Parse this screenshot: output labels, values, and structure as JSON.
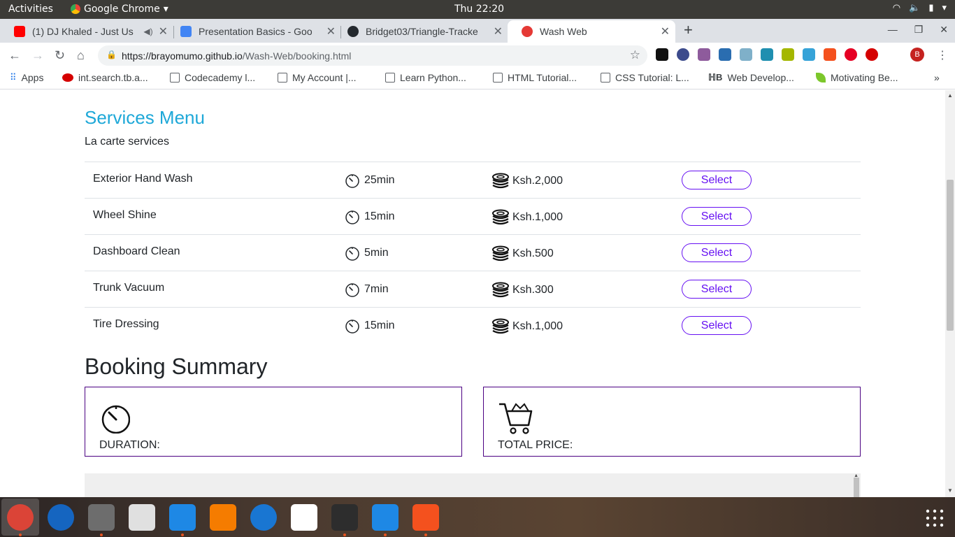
{
  "system": {
    "activities": "Activities",
    "app_name": "Google Chrome",
    "clock": "Thu 22:20"
  },
  "tabs": [
    {
      "title": "(1) DJ Khaled - Just Us",
      "icon_color": "#ff0000"
    },
    {
      "title": "Presentation Basics - Goo",
      "icon_color": "#4285f4"
    },
    {
      "title": "Bridget03/Triangle-Tracke",
      "icon_color": "#24292e"
    },
    {
      "title": "Wash Web",
      "icon_color": "#e53935"
    }
  ],
  "omnibox": {
    "host": "https://brayomumo.github.io",
    "path": "/Wash-Web/booking.html"
  },
  "bookmarks": [
    {
      "label": "Apps"
    },
    {
      "label": "int.search.tb.a..."
    },
    {
      "label": "Codecademy l..."
    },
    {
      "label": "My Account |..."
    },
    {
      "label": "Learn Python..."
    },
    {
      "label": "HTML Tutorial..."
    },
    {
      "label": "CSS Tutorial: L..."
    },
    {
      "label": "Web Develop..."
    },
    {
      "label": "Motivating Be..."
    }
  ],
  "avatar_letter": "B",
  "services": {
    "title": "Services Menu",
    "subtitle": "La carte services",
    "select_label": "Select",
    "rows": [
      {
        "name": "Exterior Hand Wash",
        "duration": "25min",
        "price": "Ksh.2,000"
      },
      {
        "name": "Wheel Shine",
        "duration": "15min",
        "price": "Ksh.1,000"
      },
      {
        "name": "Dashboard Clean",
        "duration": "5min",
        "price": "Ksh.500"
      },
      {
        "name": "Trunk Vacuum",
        "duration": "7min",
        "price": "Ksh.300"
      },
      {
        "name": "Tire Dressing",
        "duration": "15min",
        "price": "Ksh.1,000"
      }
    ]
  },
  "booking": {
    "title": "Booking Summary",
    "duration_label": "DURATION:",
    "price_label": "TOTAL PRICE:"
  },
  "colors": {
    "accent": "#1ea8d8",
    "button": "#6610f2",
    "box_border": "#4b0082"
  },
  "dock_icons": [
    "chrome-icon",
    "thunderbird-icon",
    "files-icon",
    "rhythmbox-icon",
    "writer-icon",
    "software-icon",
    "help-icon",
    "amazon-icon",
    "terminal-icon",
    "vscode-icon",
    "impress-icon"
  ]
}
